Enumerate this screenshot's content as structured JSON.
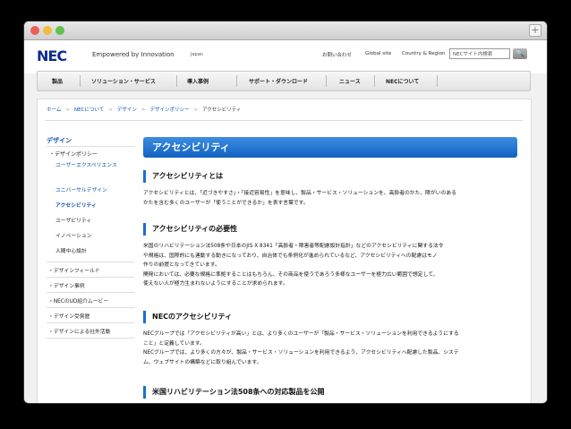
{
  "header": {
    "logo": "NEC",
    "tagline": "Empowered by Innovation",
    "region": "Japan",
    "util": [
      "お問い合わせ",
      "Global site",
      "Country & Region"
    ],
    "search_placeholder": "NECサイト内検索",
    "search_button": "🔍"
  },
  "nav": [
    "製品",
    "ソリューション・サービス",
    "導入事例",
    "サポート・ダウンロード",
    "ニュース",
    "NECについて"
  ],
  "breadcrumb": [
    "ホーム",
    "NECについて",
    "デザイン",
    "デザインポリシー",
    "アクセシビリティ"
  ],
  "sidebar": {
    "title": "デザイン",
    "group": "・デザインポリシー",
    "sub": [
      "ユーザーエクスペリエンス",
      "ユニバーサルデザイン",
      "アクセシビリティ",
      "ユーザビリティ",
      "イノベーション",
      "人間中心設計"
    ],
    "items": [
      "デザインフィールド",
      "デザイン事例",
      "NECのUD紹介ムービー",
      "デザイン受賞歴",
      "デザインによる社外活動"
    ]
  },
  "main": {
    "title": "アクセシビリティ",
    "s1": {
      "heading": "アクセシビリティとは",
      "lines": [
        "アクセシビリティとは、「近づきやすさ」・「接近容易性」を意味し、製品・サービス・ソリューションを、高齢者のかた、障がいのある",
        "かたを含む多くのユーザーが「使うことができるか」を表す言葉です。"
      ]
    },
    "s2": {
      "heading": "アクセシビリティの必要性",
      "lines": [
        "米国のリハビリテーション法508条や日本のJIS X 8341「高齢者・障害者等配慮設計指針」などのアクセシビリティに関する法令",
        "や規格は、国際的にも連動する動きになっており、自治体でも条例化が進められているなど、アクセシビリティへの配慮はモノ",
        "作りの前提となってきています。",
        "開発においては、必要な規格に準拠することはもちろん、その商品を使うであろう多様なユーザーを極力広い範囲で想定して、",
        "使えない人が極力生まれないようにすることが求められます。"
      ]
    },
    "s3": {
      "heading": "NECのアクセシビリティ",
      "lines": [
        "NECグループでは「アクセシビリティが高い」とは、より多くのユーザーが「製品・サービス・ソリューションを利用できるようにする",
        "こと」と定義しています。",
        "NECグループでは、より多くの方々が、製品・サービス・ソリューションを利用できるよう、アクセシビリティへ配慮した製品、システ",
        "ム、ウェブサイトの構築などに取り組んでいます。"
      ]
    },
    "s4": {
      "heading": "米国リハビリテーション法508条への対応製品を公開"
    }
  }
}
